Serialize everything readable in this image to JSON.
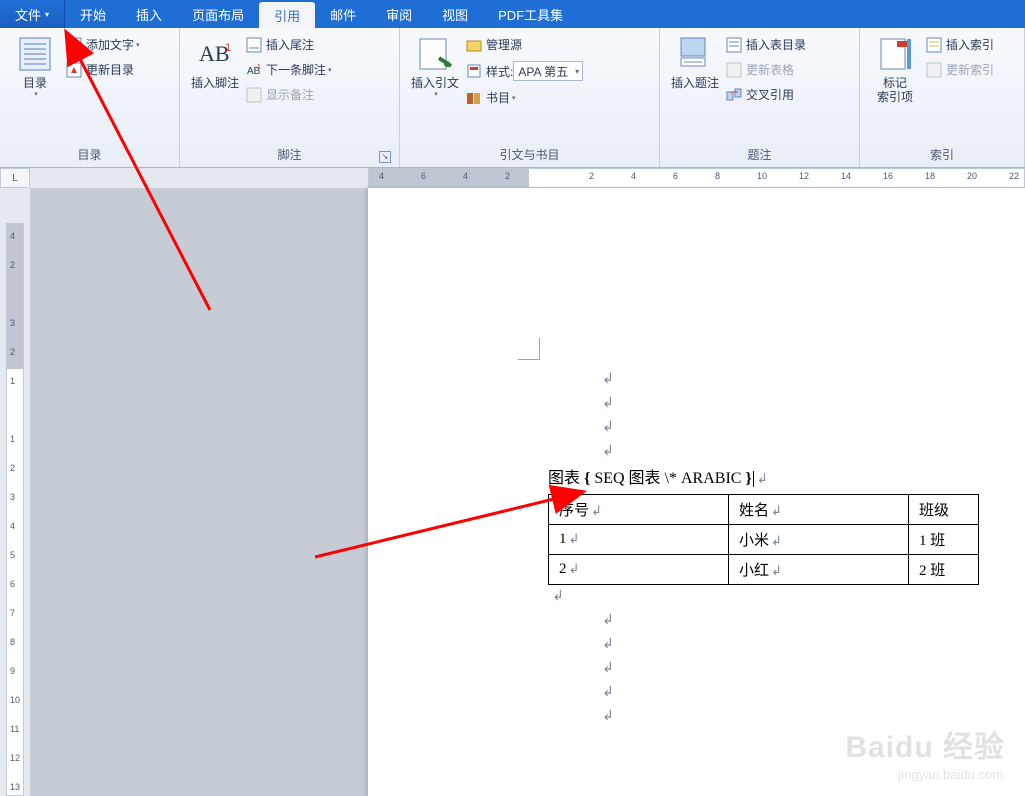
{
  "tabs": {
    "file": "文件",
    "items": [
      "开始",
      "插入",
      "页面布局",
      "引用",
      "邮件",
      "审阅",
      "视图",
      "PDF工具集"
    ],
    "selected_index": 3
  },
  "ribbon": {
    "groups": {
      "toc": {
        "label": "目录",
        "toc_button": "目录",
        "add_text": "添加文字",
        "update_toc": "更新目录"
      },
      "footnotes": {
        "label": "脚注",
        "insert_footnote": "插入脚注",
        "insert_endnote": "插入尾注",
        "next_footnote": "下一条脚注",
        "show_notes": "显示备注"
      },
      "citations": {
        "label": "引文与书目",
        "insert_citation": "插入引文",
        "manage_sources": "管理源",
        "style_label": "样式:",
        "style_value": "APA 第五",
        "bibliography": "书目"
      },
      "captions": {
        "label": "题注",
        "insert_caption": "插入题注",
        "insert_tof": "插入表目录",
        "update_table": "更新表格",
        "cross_ref": "交叉引用"
      },
      "index": {
        "label": "索引",
        "mark_entry_line1": "标记",
        "mark_entry_line2": "索引项",
        "insert_index": "插入索引",
        "update_index": "更新索引"
      }
    }
  },
  "ruler": {
    "corner": "L",
    "hticks": [
      "4",
      "6",
      "4",
      "2",
      "",
      "2",
      "4",
      "6",
      "8",
      "10",
      "12",
      "14",
      "16",
      "18",
      "20",
      "22"
    ],
    "vticks": [
      "4",
      "2",
      "",
      "3",
      "2",
      "1",
      "",
      "1",
      "2",
      "3",
      "4",
      "5",
      "6",
      "7",
      "8",
      "9",
      "10",
      "11",
      "12",
      "13"
    ]
  },
  "document": {
    "caption_prefix": "图表 ",
    "field_open": "{",
    "field_code": " SEQ 图表 \\* ARABIC ",
    "field_close": "}",
    "para_mark": "↲",
    "table": {
      "headers": [
        "序号",
        "姓名",
        "班级"
      ],
      "rows": [
        [
          "1",
          "小米",
          "1 班"
        ],
        [
          "2",
          "小红",
          "2 班"
        ]
      ]
    }
  },
  "watermark": {
    "brand": "Baidu 经验",
    "url": "jingyan.baidu.com"
  }
}
